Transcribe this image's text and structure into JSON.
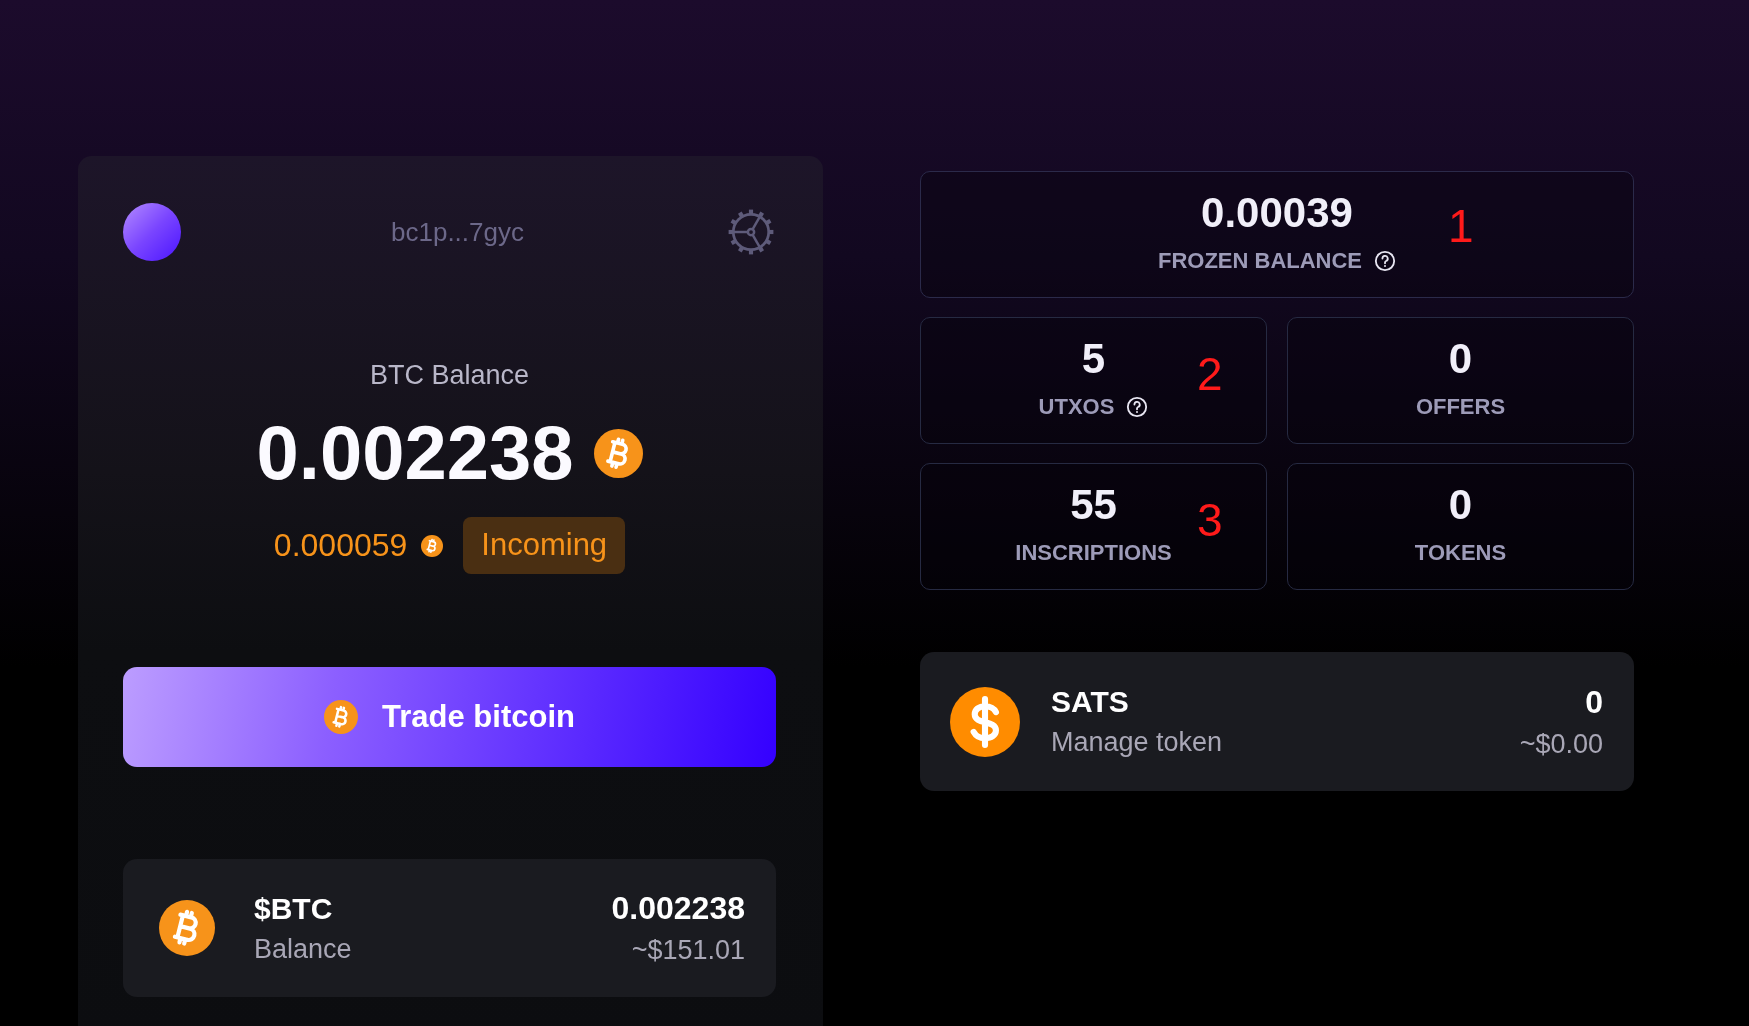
{
  "wallet": {
    "address": "bc1p...7gyc"
  },
  "balance": {
    "label": "BTC Balance",
    "amount": "0.002238",
    "pending": {
      "amount": "0.000059",
      "status": "Incoming"
    }
  },
  "trade_button": {
    "label": "Trade bitcoin"
  },
  "assets": [
    {
      "kind": "btc",
      "symbol": "$BTC",
      "subtitle": "Balance",
      "amount": "0.002238",
      "value": "~$151.01"
    }
  ],
  "stats": [
    {
      "value": "0.00039",
      "label": "FROZEN BALANCE",
      "help": true,
      "annotation": "1"
    },
    {
      "value": "5",
      "label": "UTXOS",
      "help": true,
      "annotation": "2"
    },
    {
      "value": "0",
      "label": "OFFERS",
      "help": false
    },
    {
      "value": "55",
      "label": "INSCRIPTIONS",
      "help": false,
      "annotation": "3"
    },
    {
      "value": "0",
      "label": "TOKENS",
      "help": false
    }
  ],
  "tokens": [
    {
      "kind": "dollar",
      "name": "SATS",
      "subtitle": "Manage token",
      "amount": "0",
      "value": "~$0.00"
    }
  ]
}
